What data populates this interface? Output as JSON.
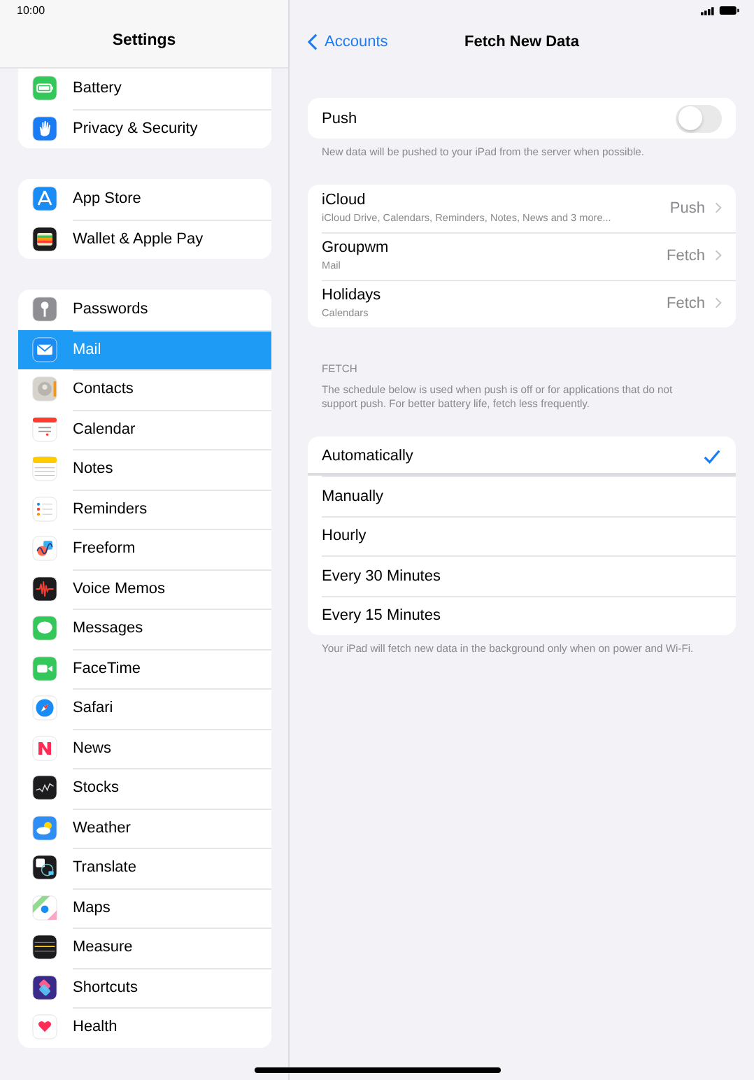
{
  "status_bar": {
    "time": "10:00"
  },
  "sidebar": {
    "title": "Settings",
    "groups": [
      {
        "items": [
          {
            "label": "Battery",
            "selected": false
          },
          {
            "label": "Privacy & Security",
            "selected": false
          }
        ]
      },
      {
        "items": [
          {
            "label": "App Store",
            "selected": false
          },
          {
            "label": "Wallet & Apple Pay",
            "selected": false
          }
        ]
      },
      {
        "items": [
          {
            "label": "Passwords",
            "selected": false
          },
          {
            "label": "Mail",
            "selected": true
          },
          {
            "label": "Contacts",
            "selected": false
          },
          {
            "label": "Calendar",
            "selected": false
          },
          {
            "label": "Notes",
            "selected": false
          },
          {
            "label": "Reminders",
            "selected": false
          },
          {
            "label": "Freeform",
            "selected": false
          },
          {
            "label": "Voice Memos",
            "selected": false
          },
          {
            "label": "Messages",
            "selected": false
          },
          {
            "label": "FaceTime",
            "selected": false
          },
          {
            "label": "Safari",
            "selected": false
          },
          {
            "label": "News",
            "selected": false
          },
          {
            "label": "Stocks",
            "selected": false
          },
          {
            "label": "Weather",
            "selected": false
          },
          {
            "label": "Translate",
            "selected": false
          },
          {
            "label": "Maps",
            "selected": false
          },
          {
            "label": "Measure",
            "selected": false
          },
          {
            "label": "Shortcuts",
            "selected": false
          },
          {
            "label": "Health",
            "selected": false
          }
        ]
      }
    ]
  },
  "detail": {
    "back": "Accounts",
    "title": "Fetch New Data",
    "push": {
      "label": "Push",
      "on": false,
      "footer": "New data will be pushed to your iPad from the server when possible."
    },
    "accounts": [
      {
        "name": "iCloud",
        "detail": "iCloud Drive, Calendars, Reminders, Notes, News and 3 more...",
        "value": "Push"
      },
      {
        "name": "Groupwm",
        "detail": "Mail",
        "value": "Fetch"
      },
      {
        "name": "Holidays",
        "detail": "Calendars",
        "value": "Fetch"
      }
    ],
    "fetch_header": "FETCH",
    "fetch_note": "The schedule below is used when push is off or for applications that do not support push. For better battery life, fetch less frequently.",
    "options": [
      {
        "label": "Automatically",
        "selected": true
      },
      {
        "label": "Manually",
        "selected": false
      },
      {
        "label": "Hourly",
        "selected": false
      },
      {
        "label": "Every 30 Minutes",
        "selected": false
      },
      {
        "label": "Every 15 Minutes",
        "selected": false
      }
    ],
    "footer": "Your iPad will fetch new data in the background only when on power and Wi-Fi."
  }
}
